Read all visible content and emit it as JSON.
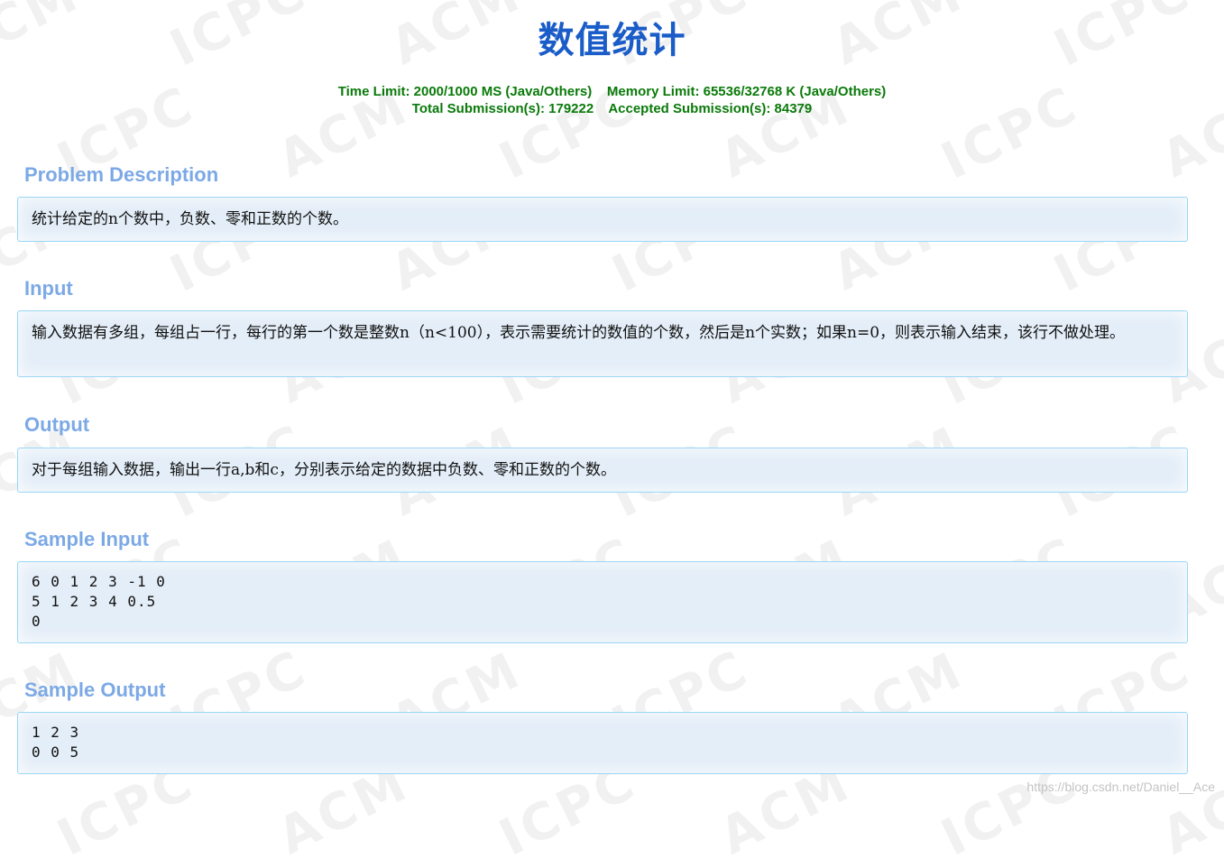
{
  "watermark": {
    "words": [
      "ACM",
      "ICPC"
    ]
  },
  "problem": {
    "title": "数值统计",
    "limits_line1": "Time Limit: 2000/1000 MS (Java/Others)    Memory Limit: 65536/32768 K (Java/Others)",
    "limits_line2": "Total Submission(s): 179222    Accepted Submission(s): 84379"
  },
  "sections": {
    "description": {
      "heading": "Problem Description",
      "body": "统计给定的n个数中，负数、零和正数的个数。"
    },
    "input": {
      "heading": "Input",
      "body": "输入数据有多组，每组占一行，每行的第一个数是整数n（n<100），表示需要统计的数值的个数，然后是n个实数；如果n=0，则表示输入结束，该行不做处理。"
    },
    "output": {
      "heading": "Output",
      "body": "对于每组输入数据，输出一行a,b和c，分别表示给定的数据中负数、零和正数的个数。"
    },
    "sample_input": {
      "heading": "Sample Input",
      "body": "6 0 1 2 3 -1 0\n5 1 2 3 4 0.5\n0"
    },
    "sample_output": {
      "heading": "Sample Output",
      "body": "1 2 3\n0 0 5"
    }
  },
  "credit": "https://blog.csdn.net/Daniel__Ace"
}
